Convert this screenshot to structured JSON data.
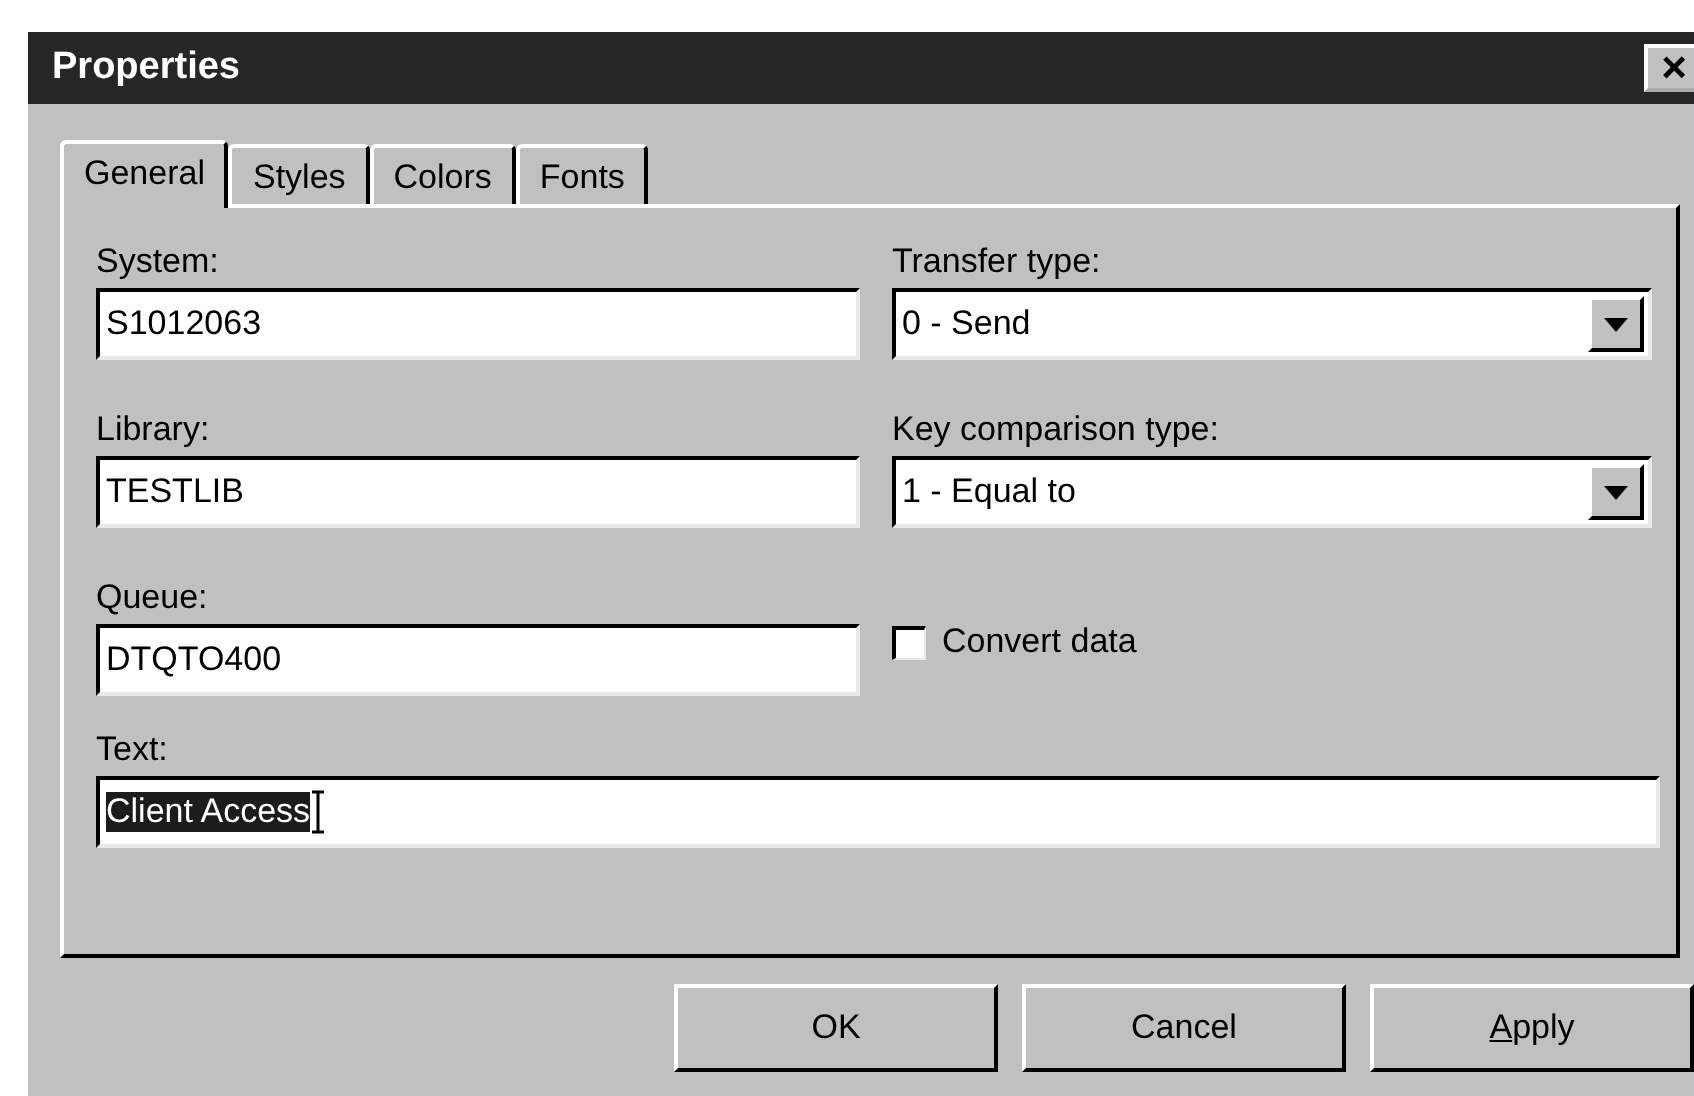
{
  "window": {
    "title": "Properties",
    "close": "×"
  },
  "tabs": [
    {
      "label": "General",
      "selected": true
    },
    {
      "label": "Styles",
      "selected": false
    },
    {
      "label": "Colors",
      "selected": false
    },
    {
      "label": "Fonts",
      "selected": false
    }
  ],
  "left_fields": [
    {
      "label": "System:",
      "value": "S1012063"
    },
    {
      "label": "Library:",
      "value": "TESTLIB"
    },
    {
      "label": "Queue:",
      "value": "DTQTO400"
    }
  ],
  "right_fields": [
    {
      "label": "Transfer type:",
      "value": "0 - Send"
    },
    {
      "label": "Key comparison type:",
      "value": "1 - Equal to"
    }
  ],
  "convert_data": {
    "label": "Convert data",
    "checked": false
  },
  "text_field": {
    "label": "Text:",
    "value": "Client Access",
    "selected": true
  },
  "buttons": [
    {
      "label": "OK",
      "underline_first": false
    },
    {
      "label": "Cancel",
      "underline_first": false
    },
    {
      "label": "Apply",
      "underline_first": true
    }
  ]
}
